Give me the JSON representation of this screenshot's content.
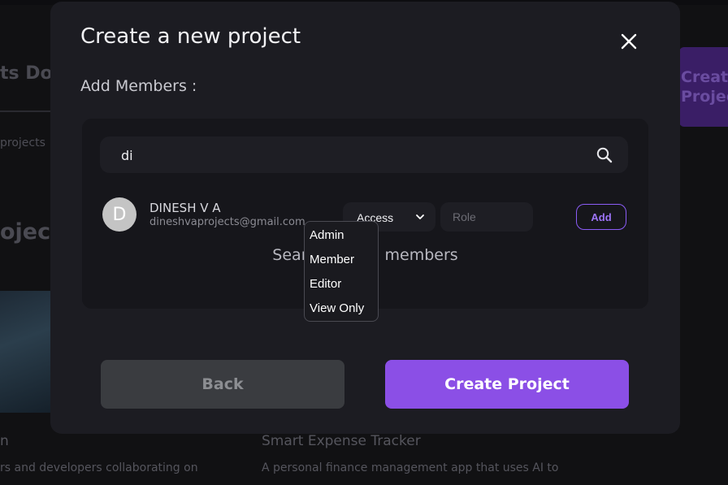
{
  "background": {
    "dashboard_title": "ts Do",
    "subtitle": "projects",
    "projects_heading": "oject",
    "create_button_label": "Creat Projec",
    "card_left_title": "n",
    "card_left_desc": "rs and developers collaborating on",
    "card_right_title": "Smart Expense Tracker",
    "card_right_desc": "A personal finance management app that uses AI to"
  },
  "modal": {
    "title": "Create a new project",
    "close_icon": "close-icon",
    "section_label": "Add Members :",
    "search": {
      "value": "di",
      "icon": "search-icon"
    },
    "member": {
      "avatar_initial": "D",
      "name": "DINESH V A",
      "email": "dineshvaprojects@gmail.com",
      "access_label": "Access",
      "role_placeholder": "Role",
      "add_label": "Add"
    },
    "empty_hint": "Search to add members",
    "access_options": [
      "Admin",
      "Member",
      "Editor",
      "View Only"
    ],
    "back_label": "Back",
    "create_label": "Create Project"
  },
  "colors": {
    "accent": "#8b4fe6",
    "modal_bg": "#1c1c22",
    "panel_bg": "#16161b",
    "back_button": "#3a3c40"
  }
}
